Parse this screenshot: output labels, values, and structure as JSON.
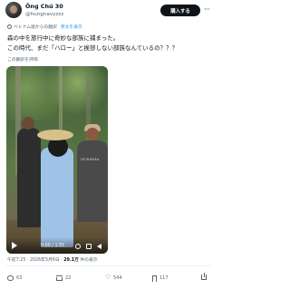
{
  "header": {
    "display_name": "Ông Chú 30",
    "handle": "@hungnavyzzz",
    "subscribe_label": "購入する",
    "more_label": "···"
  },
  "translation": {
    "note": "ベトナム語からの翻訳",
    "show_original": "原文を表示"
  },
  "tweet": {
    "line1": "森の中を旅行中に奇妙な部族に捕まった。",
    "line2": "この時代、まだ「ハロー」と挨拶しない部族なんているの？？？",
    "rate_translation": "この翻訳を評価"
  },
  "video": {
    "time": "0:00 / 1:55",
    "shirt_text": "OCEANIA"
  },
  "meta": {
    "time": "午前7:25 · 2026年5月6日 · ",
    "views_count": "29.1万",
    "views_label": " 件の表示"
  },
  "actions": {
    "replies": "63",
    "retweets": "22",
    "likes": "544",
    "bookmarks": "117"
  }
}
